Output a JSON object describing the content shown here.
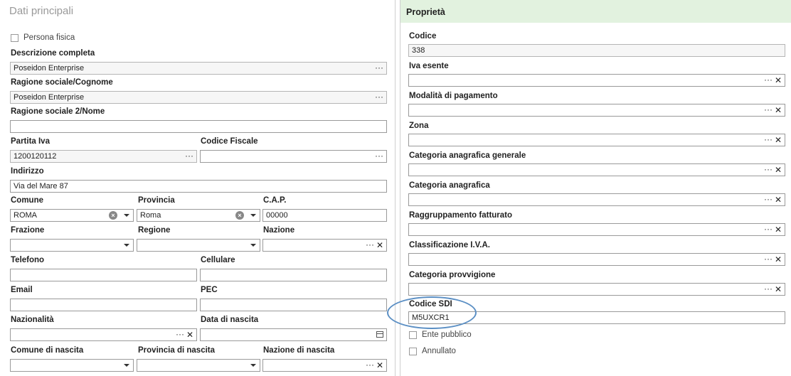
{
  "left": {
    "title": "Dati principali",
    "persona_fisica": "Persona fisica",
    "descrizione_label": "Descrizione completa",
    "descrizione_value": "Poseidon Enterprise",
    "ragione_label": "Ragione sociale/Cognome",
    "ragione_value": "Poseidon Enterprise",
    "ragione2_label": "Ragione sociale 2/Nome",
    "ragione2_value": "",
    "piva_label": "Partita Iva",
    "piva_value": "1200120112",
    "cf_label": "Codice Fiscale",
    "cf_value": "",
    "indirizzo_label": "Indirizzo",
    "indirizzo_value": "Via del Mare 87",
    "comune_label": "Comune",
    "comune_value": "ROMA",
    "provincia_label": "Provincia",
    "provincia_value": "Roma",
    "cap_label": "C.A.P.",
    "cap_value": "00000",
    "frazione_label": "Frazione",
    "regione_label": "Regione",
    "nazione_label": "Nazione",
    "telefono_label": "Telefono",
    "cellulare_label": "Cellulare",
    "email_label": "Email",
    "pec_label": "PEC",
    "nazionalita_label": "Nazionalità",
    "data_nascita_label": "Data di nascita",
    "comune_nascita_label": "Comune di nascita",
    "provincia_nascita_label": "Provincia di nascita",
    "nazione_nascita_label": "Nazione di nascita"
  },
  "right": {
    "title": "Proprietà",
    "codice_label": "Codice",
    "codice_value": "338",
    "iva_esente_label": "Iva esente",
    "modalita_label": "Modalità di pagamento",
    "zona_label": "Zona",
    "cat_generale_label": "Categoria anagrafica generale",
    "cat_label": "Categoria anagrafica",
    "raggr_label": "Raggruppamento fatturato",
    "classif_label": "Classificazione I.V.A.",
    "provv_label": "Categoria provvigione",
    "sdi_label": "Codice SDI",
    "sdi_value": "M5UXCR1",
    "ente_label": "Ente pubblico",
    "annullato_label": "Annullato"
  },
  "glyphs": {
    "ellipsis": "···",
    "clear": "✕",
    "circle_x": "×"
  },
  "colors": {
    "header_bg": "#e2f2df",
    "highlight_oval": "#5b8fc4"
  }
}
